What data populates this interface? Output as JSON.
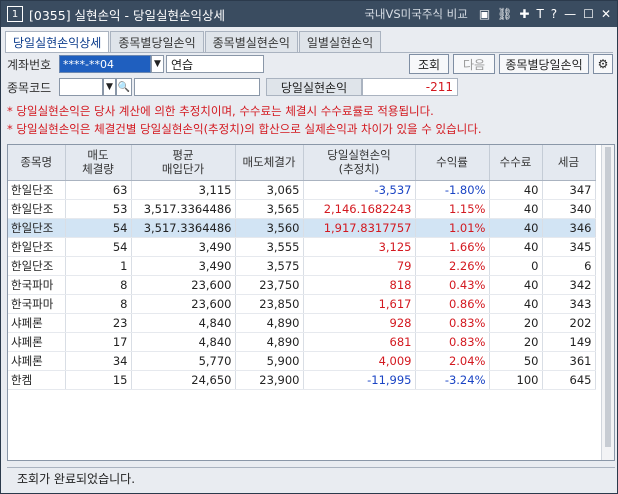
{
  "titlebar": {
    "number": "1",
    "title": "[0355] 실현손익 - 당일실현손익상세",
    "link": "국내VS미국주식 비교",
    "icons": [
      "monitor-icon",
      "link-icon",
      "pin-icon",
      "font-icon",
      "help-icon",
      "minimize-icon",
      "maximize-icon",
      "close-icon"
    ],
    "icon_glyphs": [
      "▣",
      "⛓",
      "✚",
      "T",
      "?",
      "—",
      "☐",
      "✕"
    ]
  },
  "tabs": [
    "당일실현손익상세",
    "종목별당일손익",
    "종목별실현손익",
    "일별실현손익"
  ],
  "form": {
    "account_label": "계좌번호",
    "account_value": "****-**04",
    "account_name": "연습",
    "code_label": "종목코드",
    "code_value": "",
    "pnl_label": "당일실현손익",
    "pnl_value": "-211",
    "query_button": "조회",
    "next_button": "다음",
    "by_stock_button": "종목별당일손익"
  },
  "notes": [
    "* 당일실현손익은 당사 계산에 의한 추정치이며, 수수료는 체결시 수수료률로 적용됩니다.",
    "* 당일실현손익은 체결건별 당일실현손익(추정치)의 합산으로 실제손익과 차이가 있을 수 있습니다."
  ],
  "table": {
    "headers": [
      [
        "종목명"
      ],
      [
        "매도",
        "체결량"
      ],
      [
        "평균",
        "매입단가"
      ],
      [
        "매도체결가"
      ],
      [
        "당일실현손익",
        "(추정치)"
      ],
      [
        "수익률"
      ],
      [
        "수수료"
      ],
      [
        "세금"
      ]
    ],
    "rows": [
      {
        "name": "한일단조",
        "qty": "63",
        "avg": "3,115",
        "sell": "3,065",
        "pnl": "-3,537",
        "rate": "-1.80%",
        "fee": "40",
        "tax": "347",
        "sign": "neg"
      },
      {
        "name": "한일단조",
        "qty": "53",
        "avg": "3,517.3364486",
        "sell": "3,565",
        "pnl": "2,146.1682243",
        "rate": "1.15%",
        "fee": "40",
        "tax": "340",
        "sign": "pos"
      },
      {
        "name": "한일단조",
        "qty": "54",
        "avg": "3,517.3364486",
        "sell": "3,560",
        "pnl": "1,917.8317757",
        "rate": "1.01%",
        "fee": "40",
        "tax": "346",
        "sign": "pos",
        "selected": true
      },
      {
        "name": "한일단조",
        "qty": "54",
        "avg": "3,490",
        "sell": "3,555",
        "pnl": "3,125",
        "rate": "1.66%",
        "fee": "40",
        "tax": "345",
        "sign": "pos"
      },
      {
        "name": "한일단조",
        "qty": "1",
        "avg": "3,490",
        "sell": "3,575",
        "pnl": "79",
        "rate": "2.26%",
        "fee": "0",
        "tax": "6",
        "sign": "pos"
      },
      {
        "name": "한국파마",
        "qty": "8",
        "avg": "23,600",
        "sell": "23,750",
        "pnl": "818",
        "rate": "0.43%",
        "fee": "40",
        "tax": "342",
        "sign": "pos"
      },
      {
        "name": "한국파마",
        "qty": "8",
        "avg": "23,600",
        "sell": "23,850",
        "pnl": "1,617",
        "rate": "0.86%",
        "fee": "40",
        "tax": "343",
        "sign": "pos"
      },
      {
        "name": "샤페론",
        "qty": "23",
        "avg": "4,840",
        "sell": "4,890",
        "pnl": "928",
        "rate": "0.83%",
        "fee": "20",
        "tax": "202",
        "sign": "pos"
      },
      {
        "name": "샤페론",
        "qty": "17",
        "avg": "4,840",
        "sell": "4,890",
        "pnl": "681",
        "rate": "0.83%",
        "fee": "20",
        "tax": "149",
        "sign": "pos"
      },
      {
        "name": "샤페론",
        "qty": "34",
        "avg": "5,770",
        "sell": "5,900",
        "pnl": "4,009",
        "rate": "2.04%",
        "fee": "50",
        "tax": "361",
        "sign": "pos"
      },
      {
        "name": "한켐",
        "qty": "15",
        "avg": "24,650",
        "sell": "23,900",
        "pnl": "-11,995",
        "rate": "-3.24%",
        "fee": "100",
        "tax": "645",
        "sign": "neg"
      }
    ]
  },
  "status": "조회가 완료되었습니다."
}
